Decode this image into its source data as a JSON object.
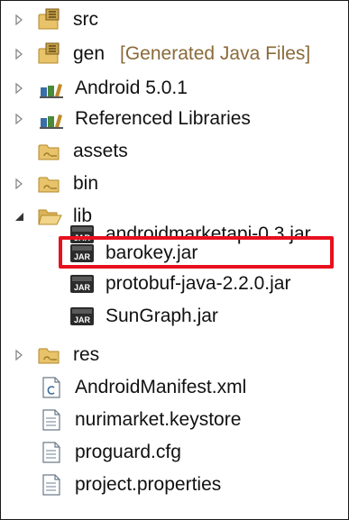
{
  "tree": {
    "items": [
      {
        "label": "src",
        "icon": "java-source-package-icon"
      },
      {
        "label": "gen",
        "decoration": "[Generated Java Files]",
        "icon": "java-source-package-icon"
      },
      {
        "label": "Android 5.0.1",
        "icon": "library-icon"
      },
      {
        "label": "Referenced Libraries",
        "icon": "library-icon"
      },
      {
        "label": "assets",
        "icon": "folder-icon"
      },
      {
        "label": "bin",
        "icon": "folder-icon"
      },
      {
        "label": "lib",
        "icon": "folder-icon"
      },
      {
        "label": "androidmarketapi-0.3.jar",
        "icon": "jar-icon"
      },
      {
        "label": "barokey.jar",
        "icon": "jar-icon",
        "highlighted": true
      },
      {
        "label": "protobuf-java-2.2.0.jar",
        "icon": "jar-icon"
      },
      {
        "label": "SunGraph.jar",
        "icon": "jar-icon"
      },
      {
        "label": "res",
        "icon": "folder-icon"
      },
      {
        "label": "AndroidManifest.xml",
        "icon": "xml-file-icon"
      },
      {
        "label": "nurimarket.keystore",
        "icon": "file-icon"
      },
      {
        "label": "proguard.cfg",
        "icon": "file-icon"
      },
      {
        "label": "project.properties",
        "icon": "file-icon"
      }
    ]
  },
  "colors": {
    "highlight": "#e8101e",
    "folder": "#e8c36a",
    "decoration": "#8a6a3a"
  }
}
